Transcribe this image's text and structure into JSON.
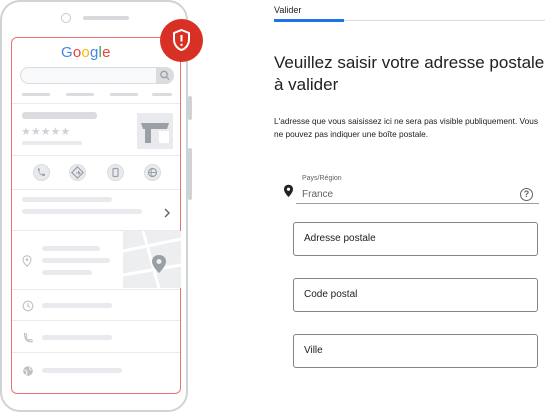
{
  "phone_mockup": {
    "logo": [
      "G",
      "o",
      "o",
      "g",
      "l",
      "e"
    ],
    "logo_colors": [
      "#4285F4",
      "#EA4335",
      "#FBBC05",
      "#4285F4",
      "#34A853",
      "#EA4335"
    ],
    "stars": [
      "★",
      "★",
      "★",
      "★",
      "★"
    ],
    "badge_icon": "shield-alert-icon",
    "badge_color": "#D93025"
  },
  "tab": {
    "label": "Valider",
    "accent": "#1A73E8"
  },
  "form": {
    "title": "Veuillez saisir votre adresse postale à valider",
    "description": "L'adresse que vous saisissez ici ne sera pas visible publiquement. Vous ne pouvez pas indiquer une boîte postale.",
    "country": {
      "label": "Pays/Région",
      "value": "France",
      "icon": "location-pin-icon",
      "help_icon": "help-circle-icon"
    },
    "fields": [
      {
        "label": "Adresse postale"
      },
      {
        "label": "Code postal"
      },
      {
        "label": "Ville"
      }
    ]
  }
}
